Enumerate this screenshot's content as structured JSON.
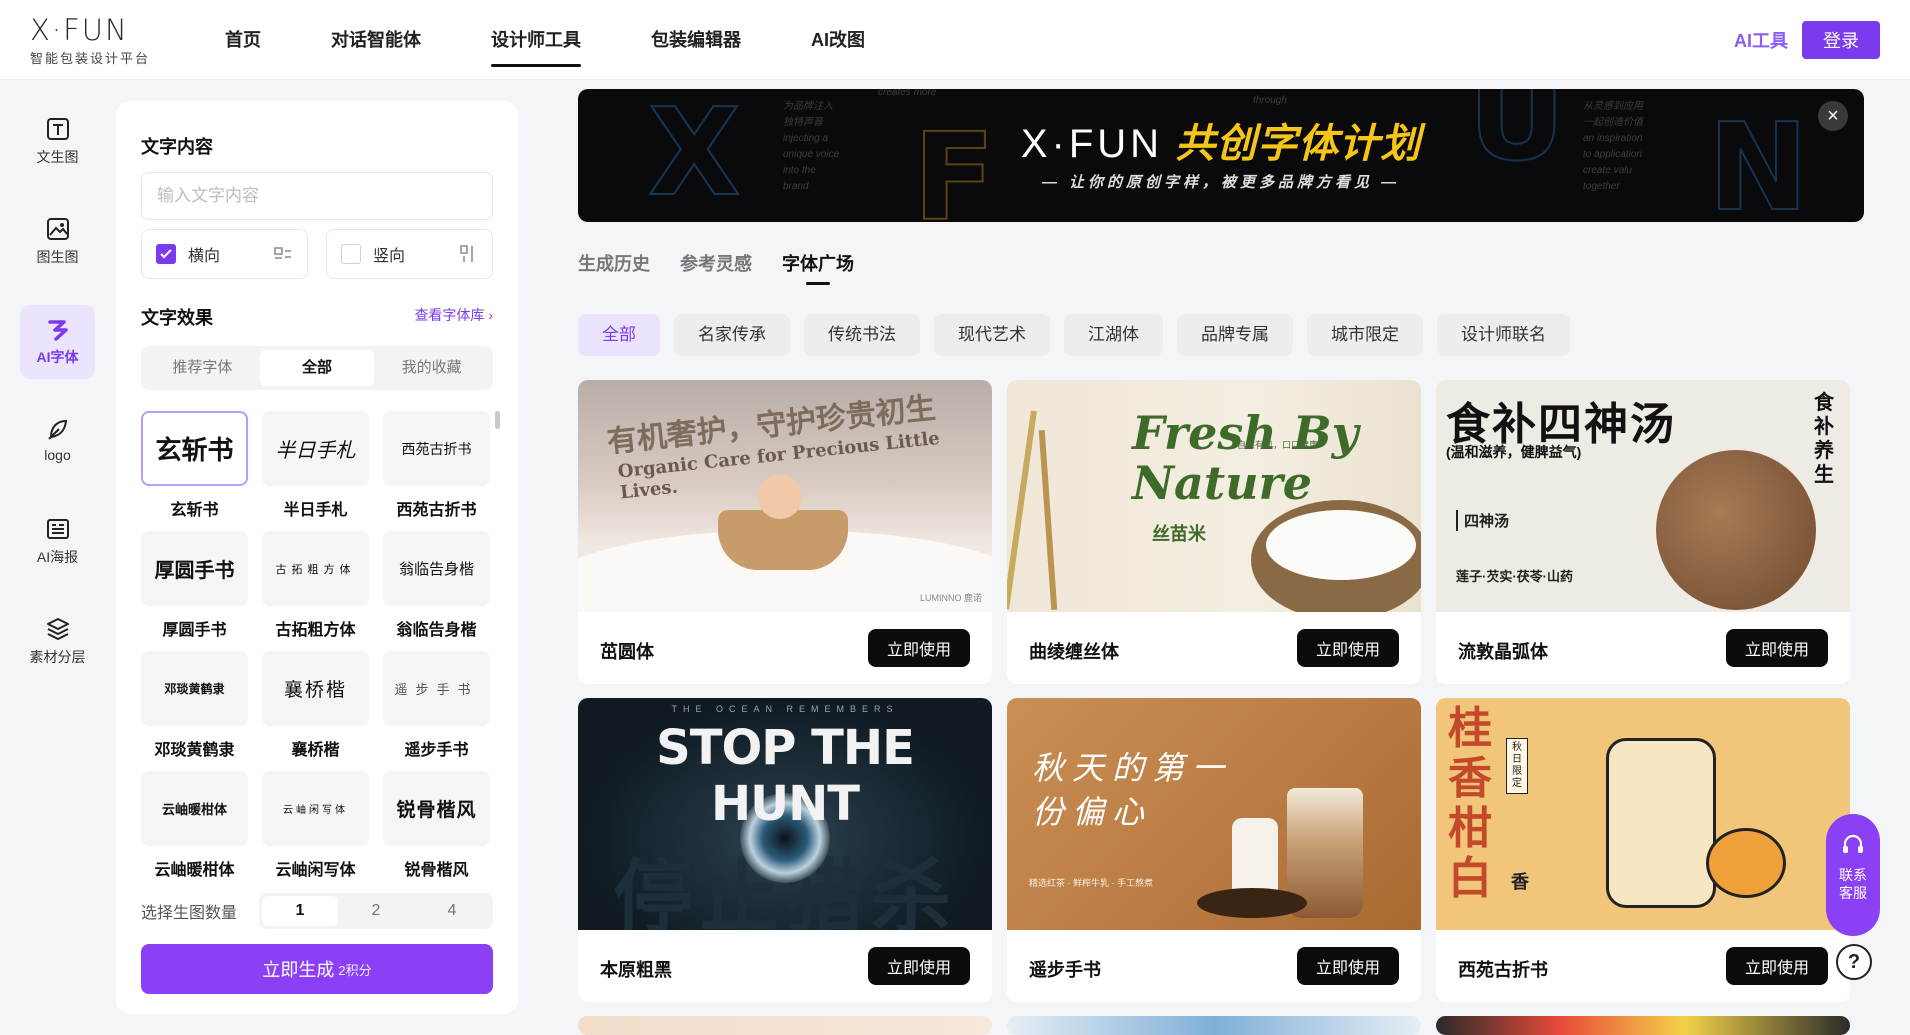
{
  "header": {
    "brand": "X·FUN",
    "brand_sub": "智能包装设计平台",
    "nav": [
      "首页",
      "对话智能体",
      "设计师工具",
      "包装编辑器",
      "AI改图"
    ],
    "ai_tools": "AI工具",
    "login": "登录"
  },
  "rail": [
    {
      "label": "文生图",
      "icon": "text-icon"
    },
    {
      "label": "图生图",
      "icon": "image-icon"
    },
    {
      "label": "AI字体",
      "icon": "ai-font-icon",
      "active": true
    },
    {
      "label": "logo",
      "icon": "feather-icon"
    },
    {
      "label": "AI海报",
      "icon": "poster-icon"
    },
    {
      "label": "素材分层",
      "icon": "layers-icon"
    }
  ],
  "panel": {
    "text_title": "文字内容",
    "text_placeholder": "输入文字内容",
    "horizontal": "横向",
    "vertical": "竖向",
    "effect_title": "文字效果",
    "library_link": "查看字体库 ›",
    "seg": [
      "推荐字体",
      "全部",
      "我的收藏"
    ],
    "fonts": [
      {
        "sample": "玄斩书",
        "name": "玄斩书"
      },
      {
        "sample": "半日手札",
        "name": "半日手札"
      },
      {
        "sample": "西苑古折书",
        "name": "西苑古折书"
      },
      {
        "sample": "厚圆手书",
        "name": "厚圆手书"
      },
      {
        "sample": "古拓粗方体",
        "name": "古拓粗方体"
      },
      {
        "sample": "翁临告身楷",
        "name": "翁临告身楷"
      },
      {
        "sample": "邓琰黄鹤隶",
        "name": "邓琰黄鹤隶"
      },
      {
        "sample": "襄桥楷",
        "name": "襄桥楷"
      },
      {
        "sample": "遥步手书",
        "name": "遥步手书"
      },
      {
        "sample": "云岫暖柑体",
        "name": "云岫暖柑体"
      },
      {
        "sample": "云岫闲写体",
        "name": "云岫闲写体"
      },
      {
        "sample": "锐骨楷风",
        "name": "锐骨楷风"
      }
    ],
    "count_label": "选择生图数量",
    "counts": [
      "1",
      "2",
      "4"
    ],
    "generate": "立即生成",
    "generate_cost": "2积分"
  },
  "banner": {
    "title_a": "X·FUN",
    "title_b": "共创字体计划",
    "subtitle": "— 让你的原创字样，被更多品牌方看见 —",
    "faint_left": [
      "为品牌注入",
      "独特声音",
      "injecting a",
      "unique voice",
      "into the",
      "brand"
    ],
    "faint_top": "creates more",
    "faint_mid": "through",
    "faint_right": [
      "从灵感到应用",
      "一起创造价值",
      "an inspiration",
      "to application",
      "create valu",
      "together"
    ]
  },
  "subtabs": [
    "生成历史",
    "参考灵感",
    "字体广场"
  ],
  "chips": [
    "全部",
    "名家传承",
    "传统书法",
    "现代艺术",
    "江湖体",
    "品牌专属",
    "城市限定",
    "设计师联名"
  ],
  "cards": [
    {
      "name": "茁圆体",
      "art_cn": "有机奢护，守护珍贵初生",
      "art_en": "Organic Care for Precious Little Lives.",
      "art_small": "LUMINNO 鹿诺"
    },
    {
      "name": "曲绫缠丝体",
      "art_en": "Fresh By Nature",
      "art_cn": "丝苗米",
      "art_small": "自然有机，口口健康"
    },
    {
      "name": "流敦晶弧体",
      "art_cn": "食补四神汤",
      "art_sub": "(温和滋养，健脾益气)",
      "art_side": "食补养生",
      "art_small": "四神汤",
      "art_small2": "莲子·芡实·茯苓·山药"
    },
    {
      "name": "本原粗黑",
      "art_en": "STOP THE HUNT",
      "art_cn": "停止猎杀",
      "art_small": "THE OCEAN REMEMBERS"
    },
    {
      "name": "遥步手书",
      "art_cn": "秋天的第一份偏心",
      "art_small": "精选红茶 · 鲜榨牛乳 · 手工熬煮"
    },
    {
      "name": "西苑古折书",
      "art_cn": "桂香柑白",
      "art_small": "秋日限定",
      "art_side": "香"
    }
  ],
  "use_label": "立即使用",
  "contact": "联系客服",
  "help": "?",
  "colors": {
    "accent": "#7c3aed",
    "accent_soft": "#ebe2fd",
    "dark": "#0c0c0c"
  }
}
